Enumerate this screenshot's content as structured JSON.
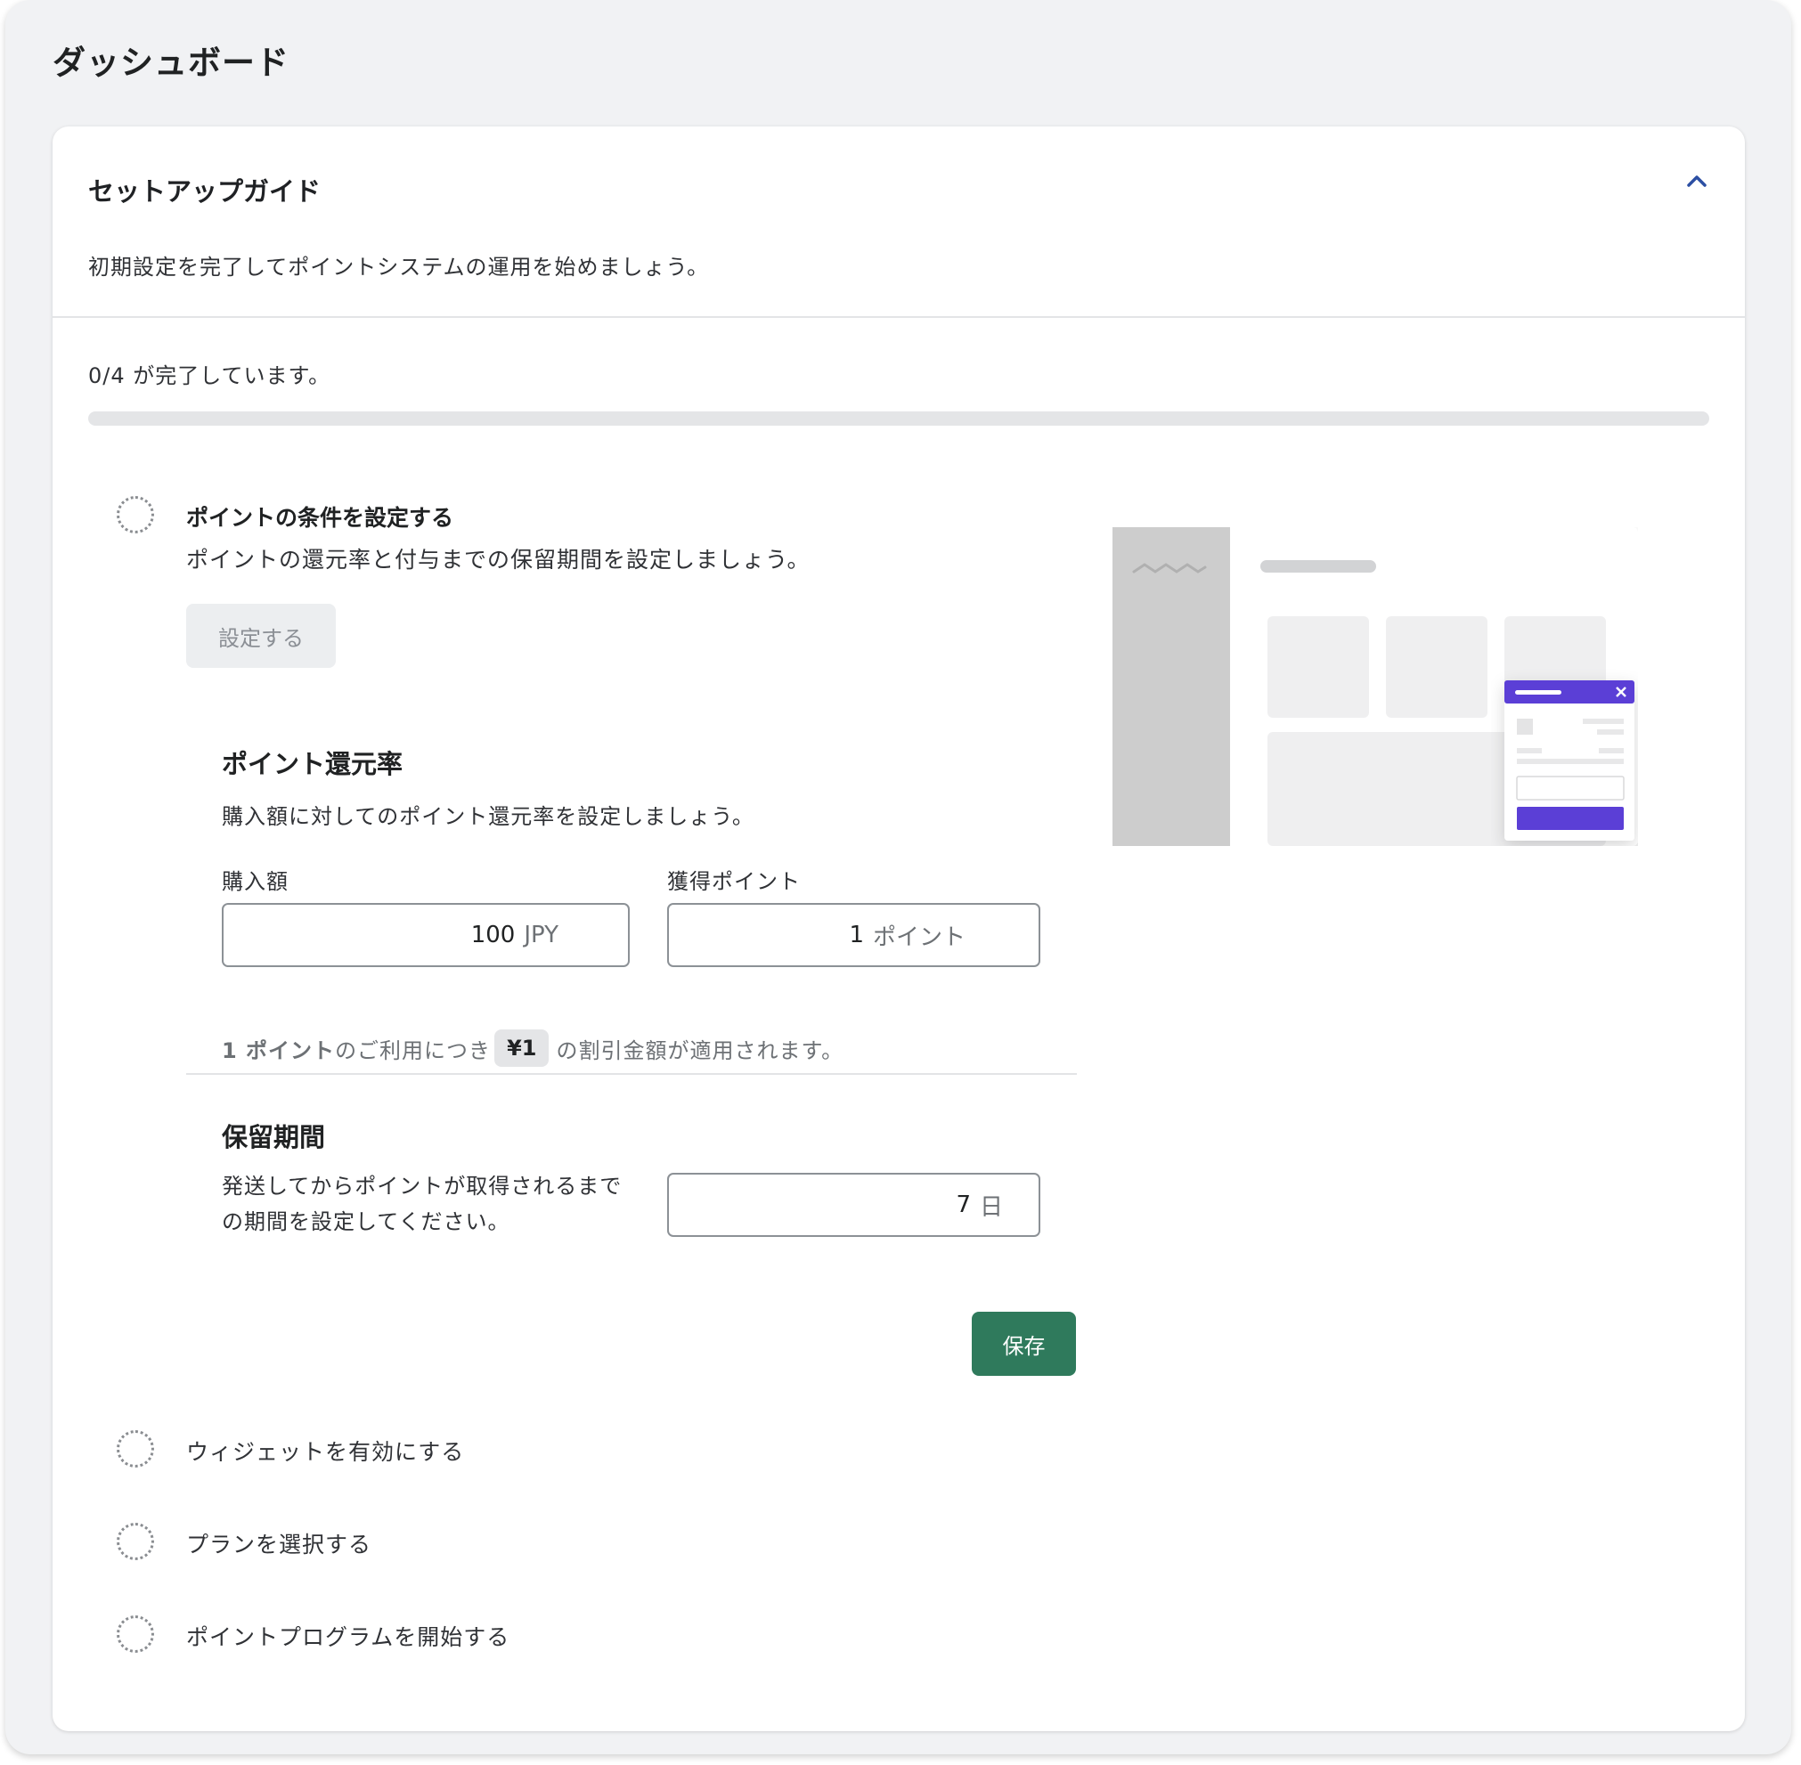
{
  "page": {
    "title": "ダッシュボード"
  },
  "guide": {
    "title": "セットアップガイド",
    "description": "初期設定を完了してポイントシステムの運用を始めましょう。",
    "progress_text": "0/4 が完了しています。",
    "progress_fraction": 0,
    "collapse_icon": "chevron-up-icon"
  },
  "steps": [
    {
      "title": "ポイントの条件を設定する",
      "description": "ポイントの還元率と付与までの保留期間を設定しましょう。",
      "button_label": "設定する",
      "completed": false
    },
    {
      "title": "ウィジェットを有効にする",
      "completed": false
    },
    {
      "title": "プランを選択する",
      "completed": false
    },
    {
      "title": "ポイントプログラムを開始する",
      "completed": false
    }
  ],
  "rate": {
    "title": "ポイント還元率",
    "description": "購入額に対してのポイント還元率を設定しましょう。",
    "purchase_label": "購入額",
    "purchase_value": "100",
    "purchase_suffix": "JPY",
    "points_label": "獲得ポイント",
    "points_value": "1",
    "points_suffix": "ポイント",
    "note_points": "1 ポイント",
    "note_mid": "のご利用につき",
    "note_amount": "¥1",
    "note_end": "の割引金額が適用されます。"
  },
  "hold": {
    "title": "保留期間",
    "description": "発送してからポイントが取得されるまでの期間を設定してください。",
    "value": "7",
    "suffix": "日"
  },
  "save_label": "保存",
  "colors": {
    "primary": "#2f7a5c",
    "accent": "#5b3fd6",
    "chevron": "#2c4fa3",
    "background": "#f1f2f4"
  }
}
